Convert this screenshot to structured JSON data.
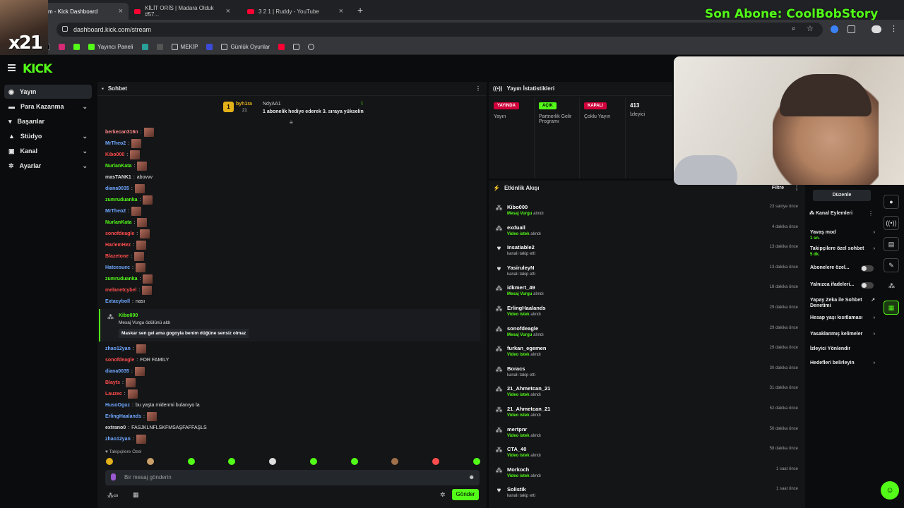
{
  "browser": {
    "tabs": [
      {
        "title": "m - Kick Dashboard",
        "active": true
      },
      {
        "title": "KİLİT ORİS | Madara Olduk #57...",
        "active": false
      },
      {
        "title": "3 2 1 | Ruddy - YouTube",
        "active": false
      }
    ],
    "url": "dashboard.kick.com/stream",
    "bookmarks": [
      "Yayıncı Paneli",
      "MEKİP",
      "Günlük Oyunlar"
    ]
  },
  "overlay": {
    "son_abone": "Son Abone: CoolBobStory",
    "cam_label": "x21"
  },
  "kick": {
    "logo": "KICK",
    "sidebar": [
      {
        "label": "Yayın",
        "icon": "broadcast-icon",
        "chevron": false
      },
      {
        "label": "Para Kazanma",
        "icon": "money-icon",
        "chevron": true
      },
      {
        "label": "Başarılar",
        "icon": "trophy-icon",
        "chevron": false
      },
      {
        "label": "Stüdyo",
        "icon": "studio-icon",
        "chevron": true
      },
      {
        "label": "Kanal",
        "icon": "channel-icon",
        "chevron": true
      },
      {
        "label": "Ayarlar",
        "icon": "settings-icon",
        "chevron": true
      }
    ],
    "chat": {
      "title": "Sohbet",
      "pinned": {
        "user": "byh1ra",
        "count": "21",
        "target": "NdyAA1",
        "right_count": "1",
        "text": "1 abonelik hediye ederek 3. sıraya yükselin"
      },
      "messages": [
        {
          "user": "berkecan316n",
          "color": "#ff8a8a",
          "text": ""
        },
        {
          "user": "MrTheo2",
          "color": "#6fa8ff",
          "text": ""
        },
        {
          "user": "Kibo000",
          "color": "#ff4d4d",
          "text": ""
        },
        {
          "user": "NurlanKata",
          "color": "#53fc18",
          "text": ""
        },
        {
          "user": "masTANK1",
          "color": "#dddddd",
          "text": "abovvv"
        },
        {
          "user": "diana0035",
          "color": "#6fa8ff",
          "text": ""
        },
        {
          "user": "zumruduanka",
          "color": "#53fc18",
          "text": ""
        },
        {
          "user": "MrTheo2",
          "color": "#6fa8ff",
          "text": ""
        },
        {
          "user": "NurlanKata",
          "color": "#53fc18",
          "text": ""
        },
        {
          "user": "sonofdeagle",
          "color": "#ff4d4d",
          "text": ""
        },
        {
          "user": "HarlemHez",
          "color": "#ff4d4d",
          "text": ""
        },
        {
          "user": "Blazetone",
          "color": "#ff4d4d",
          "text": ""
        },
        {
          "user": "Hatcesuec",
          "color": "#6fa8ff",
          "text": ""
        },
        {
          "user": "zumruduanka",
          "color": "#53fc18",
          "text": ""
        },
        {
          "user": "melanetcybel",
          "color": "#ff4d4d",
          "text": ""
        },
        {
          "user": "Extacyboll",
          "color": "#6fa8ff",
          "text": "nası"
        }
      ],
      "highlight": {
        "user": "Kibo000",
        "action": "Mesaj Vurgu ödülünü aldı",
        "quote": "Maskar sen gel ama gogoyla benim düğüne sensiz olmaz"
      },
      "messages2": [
        {
          "user": "zhao12yan",
          "color": "#6fa8ff",
          "text": ""
        },
        {
          "user": "sonofdeagle",
          "color": "#ff4d4d",
          "text": "FOR FAMILY"
        },
        {
          "user": "diana0035",
          "color": "#6fa8ff",
          "text": ""
        },
        {
          "user": "Blayts",
          "color": "#ff4d4d",
          "text": ""
        },
        {
          "user": "Lauzec",
          "color": "#ff4d4d",
          "text": ""
        },
        {
          "user": "HusoOguz",
          "color": "#6fa8ff",
          "text": "bu yaşta midenmi bulanıyo la"
        },
        {
          "user": "ErlingHaalands",
          "color": "#6fa8ff",
          "text": ""
        },
        {
          "user": "extrano0",
          "color": "#dddddd",
          "text": "FASJKLNFLSKFMSAŞFAFFAŞLS"
        },
        {
          "user": "zhao12yan",
          "color": "#6fa8ff",
          "text": ""
        }
      ],
      "followers_label": "Takipçilere Özel",
      "input_placeholder": "Bir mesaj gönderin",
      "send_label": "Gönder"
    },
    "stats": {
      "title": "Yayın İstatistikleri",
      "items": [
        {
          "pill": "YAYINDA",
          "pill_color": "#d0003a",
          "label": "Yayın"
        },
        {
          "pill": "AÇIK",
          "pill_color": "#53fc18",
          "label": "Partnerlik Gelir Programı"
        },
        {
          "pill": "KAPALI",
          "pill_color": "#d0003a",
          "label": "Çoklu Yayın"
        },
        {
          "pill": "413",
          "pill_color": "",
          "label": "İzleyici"
        }
      ]
    },
    "feed": {
      "title": "Etkinlik Akışı",
      "filter": "Filtre",
      "events": [
        {
          "user": "Kibo000",
          "action_b": "Mesaj Vurgu",
          "action": "alındı",
          "time": "23 saniye önce",
          "icon": "gift-icon"
        },
        {
          "user": "exduall",
          "action_b": "Video istek",
          "action": "alındı",
          "time": "4 dakika önce",
          "icon": "gift-icon"
        },
        {
          "user": "Insatiable2",
          "action_b": "",
          "action": "kanalı takip etti",
          "time": "13 dakika önce",
          "icon": "heart-icon"
        },
        {
          "user": "YasiruleyN",
          "action_b": "",
          "action": "kanalı takip etti",
          "time": "13 dakika önce",
          "icon": "heart-icon"
        },
        {
          "user": "idkmert_49",
          "action_b": "Mesaj Vurgu",
          "action": "alındı",
          "time": "18 dakika önce",
          "icon": "gift-icon"
        },
        {
          "user": "ErlingHaalands",
          "action_b": "Video istek",
          "action": "alındı",
          "time": "29 dakika önce",
          "icon": "gift-icon"
        },
        {
          "user": "sonofdeagle",
          "action_b": "Mesaj Vurgu",
          "action": "alındı",
          "time": "29 dakika önce",
          "icon": "gift-icon"
        },
        {
          "user": "furkan_egemen",
          "action_b": "Video istek",
          "action": "alındı",
          "time": "29 dakika önce",
          "icon": "gift-icon"
        },
        {
          "user": "Boracs",
          "action_b": "",
          "action": "kanalı takip etti",
          "time": "30 dakika önce",
          "icon": "gift-icon"
        },
        {
          "user": "21_Ahmetcan_21",
          "action_b": "Video istek",
          "action": "alındı",
          "time": "31 dakika önce",
          "icon": "gift-icon"
        },
        {
          "user": "21_Ahmetcan_21",
          "action_b": "Video istek",
          "action": "alındı",
          "time": "52 dakika önce",
          "icon": "gift-icon"
        },
        {
          "user": "mertpnr",
          "action_b": "Video istek",
          "action": "alındı",
          "time": "56 dakika önce",
          "icon": "gift-icon"
        },
        {
          "user": "CTA_40",
          "action_b": "Video istek",
          "action": "alındı",
          "time": "58 dakika önce",
          "icon": "gift-icon"
        },
        {
          "user": "Morkoch",
          "action_b": "Video istek",
          "action": "alındı",
          "time": "1 saat önce",
          "icon": "gift-icon"
        },
        {
          "user": "Solistik",
          "action_b": "",
          "action": "kanalı takip etti",
          "time": "1 saat önce",
          "icon": "heart-icon"
        }
      ]
    },
    "actions": {
      "edit": "Düzenle",
      "title": "Kanal Eylemleri",
      "items": [
        {
          "label": "Yavaş mod",
          "sub": "1 sn.",
          "type": "chevron"
        },
        {
          "label": "Takipçilere özel sohbet",
          "sub": "5 dk.",
          "type": "chevron"
        },
        {
          "label": "Abonelere özel...",
          "sub": "",
          "type": "toggle"
        },
        {
          "label": "Yalnızca ifadeleri...",
          "sub": "",
          "type": "toggle"
        },
        {
          "label": "Yapay Zeka ile Sohbet Denetimi",
          "sub": "",
          "type": "external"
        },
        {
          "label": "Hesap yaşı kısıtlaması",
          "sub": "",
          "type": "chevron"
        },
        {
          "label": "Yasaklanmış kelimeler",
          "sub": "",
          "type": "chevron"
        },
        {
          "label": "İzleyici Yönlendir",
          "sub": "",
          "type": "none"
        },
        {
          "label": "Hedefleri belirleyin",
          "sub": "",
          "type": "chevron"
        }
      ]
    }
  }
}
